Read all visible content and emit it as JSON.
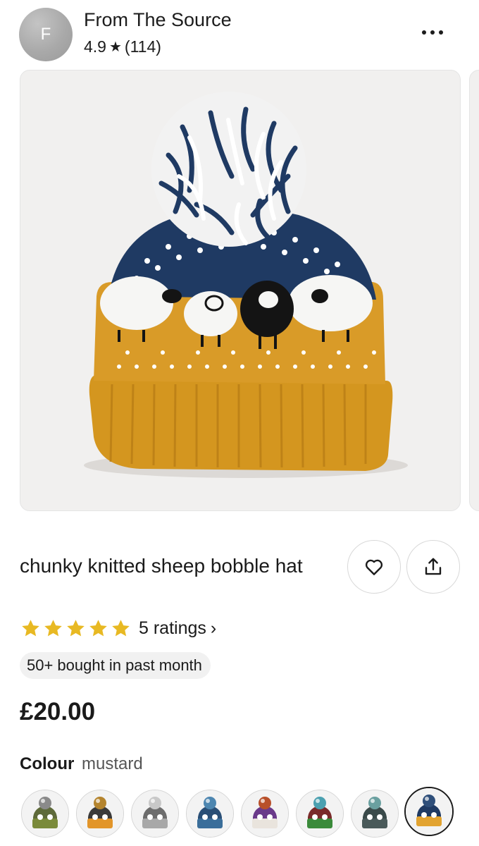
{
  "shop": {
    "avatar_initial": "F",
    "name": "From The Source",
    "rating": "4.9",
    "reviews": "(114)"
  },
  "icons": {
    "more": "more-horizontal-icon",
    "favorite": "heart-icon",
    "share": "share-icon",
    "rating_star": "star-icon"
  },
  "product": {
    "title": "chunky knitted sheep bobble hat",
    "stars": 5,
    "ratings_label": "5 ratings",
    "ratings_chevron": "›",
    "bought_badge": "50+ bought in past month",
    "price": "£20.00"
  },
  "variation": {
    "label": "Colour",
    "selected": "mustard",
    "swatches": [
      {
        "band": "#7a8a3a",
        "pom": "#8a8a8a",
        "top": "#5e6a3a"
      },
      {
        "band": "#e2952a",
        "pom": "#b4842e",
        "top": "#3a3a3a"
      },
      {
        "band": "#a8a8a8",
        "pom": "#c8c8c8",
        "top": "#6d6d6d"
      },
      {
        "band": "#3b6e9a",
        "pom": "#4d86b0",
        "top": "#2a4f76"
      },
      {
        "band": "#e9e4dd",
        "pom": "#b8502a",
        "top": "#6a3a8a"
      },
      {
        "band": "#3a8a3a",
        "pom": "#4ba0b0",
        "top": "#7a2a2a"
      },
      {
        "band": "#4a5a5a",
        "pom": "#6aa0a0",
        "top": "#3a4a4a"
      },
      {
        "band": "#e2a330",
        "pom": "#2f4f7a",
        "top": "#1f3a63"
      }
    ]
  },
  "colors": {
    "star": "#e8b923",
    "hat_mustard": "#d89a26",
    "hat_navy": "#1f3a63"
  }
}
